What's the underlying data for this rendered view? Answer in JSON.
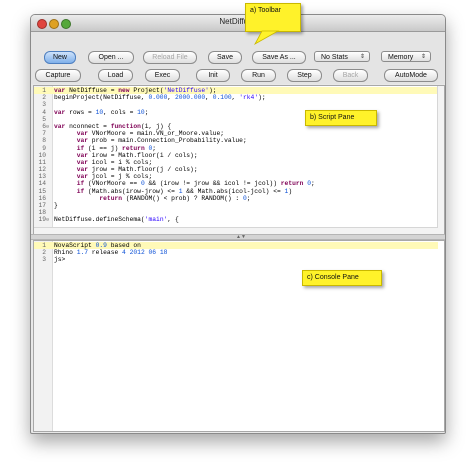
{
  "window": {
    "title": "NetDiffuse"
  },
  "toolbar": {
    "row1": {
      "new": "New",
      "open": "Open ...",
      "reload": "Reload File",
      "save": "Save",
      "save_as": "Save As ...",
      "stats_select": "No Stats",
      "memory_select": "Memory"
    },
    "row2": {
      "capture": "Capture",
      "load": "Load",
      "exec": "Exec",
      "init": "Init",
      "run": "Run",
      "step": "Step",
      "back": "Back",
      "automode": "AutoMode"
    }
  },
  "script_pane": {
    "lines": [
      {
        "n": "1",
        "fold": "",
        "html": "<span class=\"kw\">var</span> NetDiffuse = <span class=\"kw\">new</span> Project(<span class=\"st\">'NetDiffuse'</span>);",
        "highlight": true
      },
      {
        "n": "2",
        "fold": "",
        "html": "beginProject(NetDiffuse, <span class=\"nm\">0.000</span>, <span class=\"nm\">2000.000</span>, <span class=\"nm\">0.100</span>, <span class=\"st\">'rk4'</span>);"
      },
      {
        "n": "3",
        "fold": "",
        "html": ""
      },
      {
        "n": "4",
        "fold": "",
        "html": "<span class=\"kw\">var</span> rows = <span class=\"nm\">10</span>, cols = <span class=\"nm\">10</span>;"
      },
      {
        "n": "5",
        "fold": "",
        "html": ""
      },
      {
        "n": "6",
        "fold": "⊖",
        "html": "<span class=\"kw\">var</span> nconnect = <span class=\"kw\">function</span>(i, j) {"
      },
      {
        "n": "7",
        "fold": "",
        "html": "      <span class=\"kw\">var</span> VNorMoore = main.VN_or_Moore.value;"
      },
      {
        "n": "8",
        "fold": "",
        "html": "      <span class=\"kw\">var</span> prob = main.Connection_Probability.value;"
      },
      {
        "n": "9",
        "fold": "",
        "html": "      <span class=\"kw\">if</span> (i == j) <span class=\"kw\">return</span> <span class=\"nm\">0</span>;"
      },
      {
        "n": "10",
        "fold": "",
        "html": "      <span class=\"kw\">var</span> irow = Math.floor(i / cols);"
      },
      {
        "n": "11",
        "fold": "",
        "html": "      <span class=\"kw\">var</span> icol = i % cols;"
      },
      {
        "n": "12",
        "fold": "",
        "html": "      <span class=\"kw\">var</span> jrow = Math.floor(j / cols);"
      },
      {
        "n": "13",
        "fold": "",
        "html": "      <span class=\"kw\">var</span> jcol = j % cols;"
      },
      {
        "n": "14",
        "fold": "",
        "html": "      <span class=\"kw\">if</span> (VNorMoore == <span class=\"nm\">0</span> &amp;&amp; (irow != jrow &amp;&amp; icol != jcol)) <span class=\"kw\">return</span> <span class=\"nm\">0</span>;"
      },
      {
        "n": "15",
        "fold": "",
        "html": "      <span class=\"kw\">if</span> (Math.abs(irow-jrow) &lt;= <span class=\"nm\">1</span> &amp;&amp; Math.abs(icol-jcol) &lt;= <span class=\"nm\">1</span>)"
      },
      {
        "n": "16",
        "fold": "",
        "html": "            <span class=\"kw\">return</span> (RANDOM() &lt; prob) ? RANDOM() : <span class=\"nm\">0</span>;"
      },
      {
        "n": "17",
        "fold": "",
        "html": "}"
      },
      {
        "n": "18",
        "fold": "",
        "html": ""
      },
      {
        "n": "19",
        "fold": "⊖",
        "html": "NetDiffuse.defineSchema(<span class=\"st\">'main'</span>, {"
      }
    ]
  },
  "console_pane": {
    "lines": [
      {
        "n": "1",
        "html": "NovaScript <span class=\"nm\">0.9</span> based on",
        "highlight": true
      },
      {
        "n": "2",
        "html": "Rhino <span class=\"nm\">1.7</span> release <span class=\"nm\">4</span> <span class=\"nm\">2012</span> <span class=\"nm\">06</span> <span class=\"nm\">18</span>"
      },
      {
        "n": "3",
        "html": "js>"
      }
    ]
  },
  "callouts": {
    "toolbar": "a) Toolbar",
    "script": "b) Script Pane",
    "console": "c) Console Pane"
  },
  "colors": {
    "callout": "#fff22a",
    "line_highlight": "#fffab8",
    "keyword": "#7f0055",
    "string": "#2a00ff",
    "number": "#0a4fd6"
  }
}
